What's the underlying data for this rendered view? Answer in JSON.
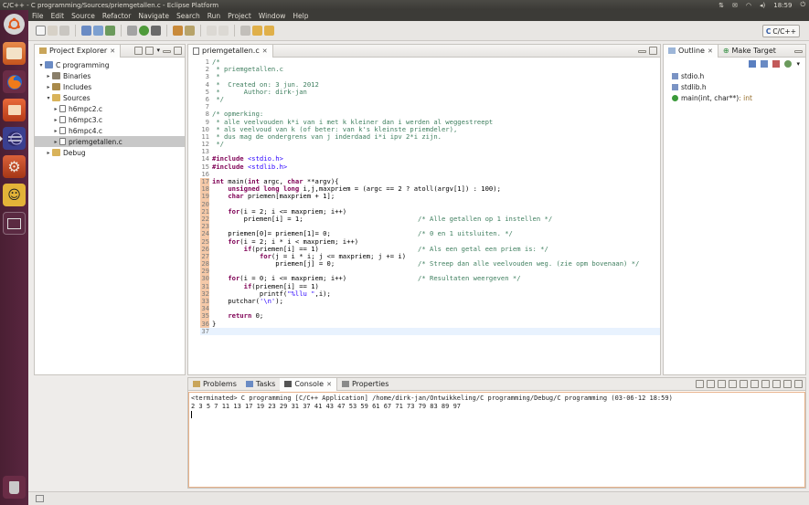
{
  "window_title": "C/C++ - C programming/Sources/priemgetallen.c - Eclipse Platform",
  "tray": {
    "clock": "18:59"
  },
  "menu": [
    "File",
    "Edit",
    "Source",
    "Refactor",
    "Navigate",
    "Search",
    "Run",
    "Project",
    "Window",
    "Help"
  ],
  "perspective": {
    "label": "C/C++"
  },
  "project_explorer": {
    "tab_label": "Project Explorer",
    "items": [
      {
        "label": "C programming",
        "level": 0,
        "twisty": "▾",
        "icon": "project-icon"
      },
      {
        "label": "Binaries",
        "level": 1,
        "twisty": "▸",
        "icon": "binaries-icon"
      },
      {
        "label": "Includes",
        "level": 1,
        "twisty": "▸",
        "icon": "includes-icon"
      },
      {
        "label": "Sources",
        "level": 1,
        "twisty": "▾",
        "icon": "folder-icon"
      },
      {
        "label": "h6mpc2.c",
        "level": 2,
        "twisty": "▸",
        "icon": "c-file-icon"
      },
      {
        "label": "h6mpc3.c",
        "level": 2,
        "twisty": "▸",
        "icon": "c-file-icon"
      },
      {
        "label": "h6mpc4.c",
        "level": 2,
        "twisty": "▸",
        "icon": "c-file-icon"
      },
      {
        "label": "priemgetallen.c",
        "level": 2,
        "twisty": "▸",
        "icon": "c-file-icon",
        "selected": true
      },
      {
        "label": "Debug",
        "level": 1,
        "twisty": "▸",
        "icon": "folder-icon"
      }
    ]
  },
  "editor": {
    "tab_label": "priemgetallen.c",
    "lines": [
      "/*",
      " * priemgetallen.c",
      " *",
      " *  Created on: 3 jun. 2012",
      " *      Author: dirk-jan",
      " */",
      "",
      "/* opmerking:",
      " * alle veelvouden k*i van i met k kleiner dan i werden al weggestreept",
      " * als veelvoud van k (of beter: van k's kleinste priemdeler),",
      " * dus mag de ondergrens van j inderdaad i*i ipv 2*i zijn.",
      " */",
      "",
      "#include <stdio.h>",
      "#include <stdlib.h>",
      "",
      "int main(int argc, char **argv){",
      "    unsigned long long i,j,maxpriem = (argc == 2 ? atoll(argv[1]) : 100);",
      "    char priemen[maxpriem + 1];",
      "",
      "    for(i = 2; i <= maxpriem; i++)",
      "        priemen[i] = 1;                             /* Alle getallen op 1 instellen */",
      "",
      "    priemen[0]= priemen[1]= 0;                      /* 0 en 1 uitsluiten. */",
      "    for(i = 2; i * i < maxpriem; i++)",
      "        if(priemen[i] == 1)                         /* Als een getal een priem is: */",
      "            for(j = i * i; j <= maxpriem; j += i)",
      "                priemen[j] = 0;                     /* Streep dan alle veelvouden weg. (zie opm bovenaan) */",
      "",
      "    for(i = 0; i <= maxpriem; i++)                  /* Resultaten weergeven */",
      "        if(priemen[i] == 1)",
      "            printf(\"%llu \",i);",
      "    putchar('\\n');",
      "",
      "    return 0;",
      "}",
      ""
    ]
  },
  "outline": {
    "tab_label": "Outline",
    "tab2_label": "Make Target",
    "items": [
      {
        "label": "stdio.h",
        "type": "include-icon"
      },
      {
        "label": "stdlib.h",
        "type": "include-icon"
      },
      {
        "label": "main(int, char**)",
        "suffix": " : int",
        "type": "function-icon"
      }
    ]
  },
  "bottom_tabs": [
    "Problems",
    "Tasks",
    "Console",
    "Properties"
  ],
  "console": {
    "header": "<terminated> C programming [C/C++ Application] /home/dirk-jan/Ontwikkeling/C programming/Debug/C programming (03-06-12 18:59)",
    "output": "2 3 5 7 11 13 17 19 23 29 31 37 41 43 47 53 59 61 67 71 73 79 83 89 97"
  },
  "colors": {
    "launcher": "#5a2640",
    "menubar": "#3c3b37",
    "selection": "#c8c8c8",
    "current_line": "#e8f2fe",
    "comment": "#3f7f5f",
    "keyword": "#7f0055",
    "string": "#2a00ff"
  }
}
